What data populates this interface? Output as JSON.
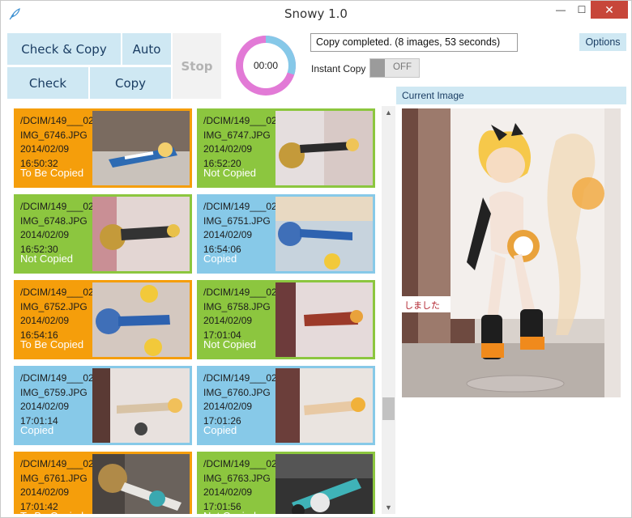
{
  "window": {
    "title": "Snowy 1.0",
    "min": "—",
    "max": "☐",
    "close": "✕"
  },
  "toolbar": {
    "check_copy": "Check & Copy",
    "auto": "Auto",
    "stop": "Stop",
    "check": "Check",
    "copy": "Copy"
  },
  "timer": {
    "value": "00:00",
    "progress_fraction": 0.3
  },
  "status": {
    "message": "Copy completed. (8 images, 53 seconds)"
  },
  "options_label": "Options",
  "instant_copy": {
    "label": "Instant Copy",
    "state": "OFF"
  },
  "current_image": {
    "header": "Current Image"
  },
  "colors": {
    "to_be_copied": "#f59e0b",
    "not_copied": "#8cc63f",
    "copied": "#87c9e8",
    "accent": "#cfe8f3",
    "timer_ring": "#e27ad6",
    "timer_fill": "#86c8e8"
  },
  "images": [
    {
      "folder": "/DCIM/149___02",
      "file": "IMG_6746.JPG",
      "date": "2014/02/09",
      "time": "16:50:32",
      "status": "To Be Copied"
    },
    {
      "folder": "/DCIM/149___02",
      "file": "IMG_6747.JPG",
      "date": "2014/02/09",
      "time": "16:52:20",
      "status": "Not Copied"
    },
    {
      "folder": "/DCIM/149___02",
      "file": "IMG_6748.JPG",
      "date": "2014/02/09",
      "time": "16:52:30",
      "status": "Not Copied"
    },
    {
      "folder": "/DCIM/149___02",
      "file": "IMG_6751.JPG",
      "date": "2014/02/09",
      "time": "16:54:06",
      "status": "Copied"
    },
    {
      "folder": "/DCIM/149___02",
      "file": "IMG_6752.JPG",
      "date": "2014/02/09",
      "time": "16:54:16",
      "status": "To Be Copied"
    },
    {
      "folder": "/DCIM/149___02",
      "file": "IMG_6758.JPG",
      "date": "2014/02/09",
      "time": "17:01:04",
      "status": "Not Copied"
    },
    {
      "folder": "/DCIM/149___02",
      "file": "IMG_6759.JPG",
      "date": "2014/02/09",
      "time": "17:01:14",
      "status": "Copied"
    },
    {
      "folder": "/DCIM/149___02",
      "file": "IMG_6760.JPG",
      "date": "2014/02/09",
      "time": "17:01:26",
      "status": "Copied"
    },
    {
      "folder": "/DCIM/149___02",
      "file": "IMG_6761.JPG",
      "date": "2014/02/09",
      "time": "17:01:42",
      "status": "To Be Copied"
    },
    {
      "folder": "/DCIM/149___02",
      "file": "IMG_6763.JPG",
      "date": "2014/02/09",
      "time": "17:01:56",
      "status": "Not Copied"
    }
  ]
}
